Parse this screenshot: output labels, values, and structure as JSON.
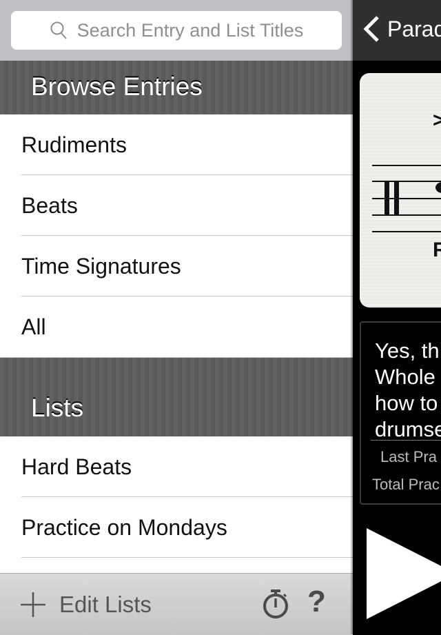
{
  "search": {
    "placeholder": "Search Entry and List Titles"
  },
  "browse": {
    "title": "Browse Entries",
    "items": [
      {
        "label": "Rudiments"
      },
      {
        "label": "Beats"
      },
      {
        "label": "Time Signatures"
      },
      {
        "label": "All"
      }
    ]
  },
  "lists": {
    "title": "Lists",
    "items": [
      {
        "label": "Hard Beats"
      },
      {
        "label": "Practice on Mondays"
      }
    ]
  },
  "toolbar": {
    "edit_lists_label": "Edit Lists",
    "help_label": "?"
  },
  "detail": {
    "back_label": "Parad",
    "notation_text": {
      "accent": ">",
      "sticking": "R"
    },
    "description_lines": [
      "Yes, th",
      "Whole",
      "how to",
      "drumse"
    ],
    "last_practiced_label": "Last Pra",
    "total_practiced_label": "Total Prac"
  }
}
